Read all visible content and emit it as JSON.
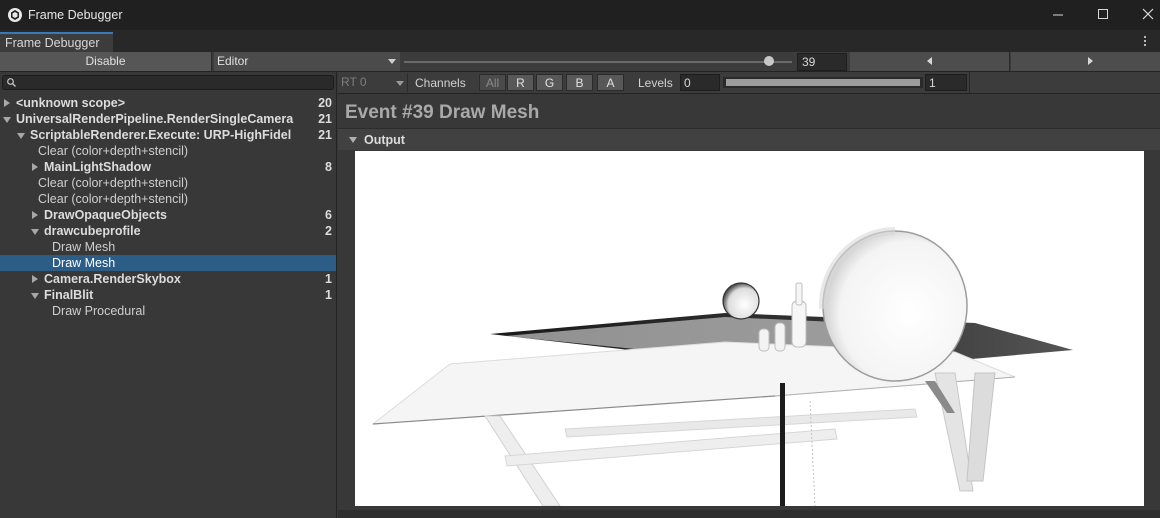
{
  "window": {
    "title": "Frame Debugger",
    "icon": "unity-logo-icon",
    "controls": [
      "minimize-icon",
      "maximize-icon",
      "close-icon"
    ]
  },
  "tab": {
    "label": "Frame Debugger"
  },
  "toolbar": {
    "disable_label": "Disable",
    "target_dropdown": "Editor",
    "event_slider_fraction": 0.94,
    "event_index": "39"
  },
  "search": {
    "placeholder": "",
    "value": ""
  },
  "tree": [
    {
      "label": "<unknown scope>",
      "count": "20",
      "bold": true,
      "depth": 0,
      "state": "collapsed"
    },
    {
      "label": "UniversalRenderPipeline.RenderSingleCamera",
      "count": "21",
      "bold": true,
      "depth": 0,
      "state": "expanded"
    },
    {
      "label": "ScriptableRenderer.Execute: URP-HighFidel",
      "count": "21",
      "bold": true,
      "depth": 1,
      "state": "expanded"
    },
    {
      "label": "Clear (color+depth+stencil)",
      "count": "",
      "bold": false,
      "depth": 2,
      "state": "leaf"
    },
    {
      "label": "MainLightShadow",
      "count": "8",
      "bold": true,
      "depth": 2,
      "state": "collapsed"
    },
    {
      "label": "Clear (color+depth+stencil)",
      "count": "",
      "bold": false,
      "depth": 2,
      "state": "leaf"
    },
    {
      "label": "Clear (color+depth+stencil)",
      "count": "",
      "bold": false,
      "depth": 2,
      "state": "leaf"
    },
    {
      "label": "DrawOpaqueObjects",
      "count": "6",
      "bold": true,
      "depth": 2,
      "state": "collapsed"
    },
    {
      "label": "drawcubeprofile",
      "count": "2",
      "bold": true,
      "depth": 2,
      "state": "expanded"
    },
    {
      "label": "Draw Mesh",
      "count": "",
      "bold": false,
      "depth": 3,
      "state": "leaf"
    },
    {
      "label": "Draw Mesh",
      "count": "",
      "bold": false,
      "depth": 3,
      "state": "leaf",
      "selected": true
    },
    {
      "label": "Camera.RenderSkybox",
      "count": "1",
      "bold": true,
      "depth": 2,
      "state": "collapsed"
    },
    {
      "label": "FinalBlit",
      "count": "1",
      "bold": true,
      "depth": 2,
      "state": "expanded"
    },
    {
      "label": "Draw Procedural",
      "count": "",
      "bold": false,
      "depth": 3,
      "state": "leaf"
    }
  ],
  "viewbar": {
    "rt_dropdown": "RT 0",
    "channels_label": "Channels",
    "channels": [
      "All",
      "R",
      "G",
      "B",
      "A"
    ],
    "levels_label": "Levels",
    "levels_min": "0",
    "levels_max": "1"
  },
  "event": {
    "title": "Event #39 Draw Mesh",
    "output_label": "Output"
  },
  "colors": {
    "selection": "#2c5d87",
    "tab_accent": "#3a79bb",
    "background": "#383838"
  }
}
